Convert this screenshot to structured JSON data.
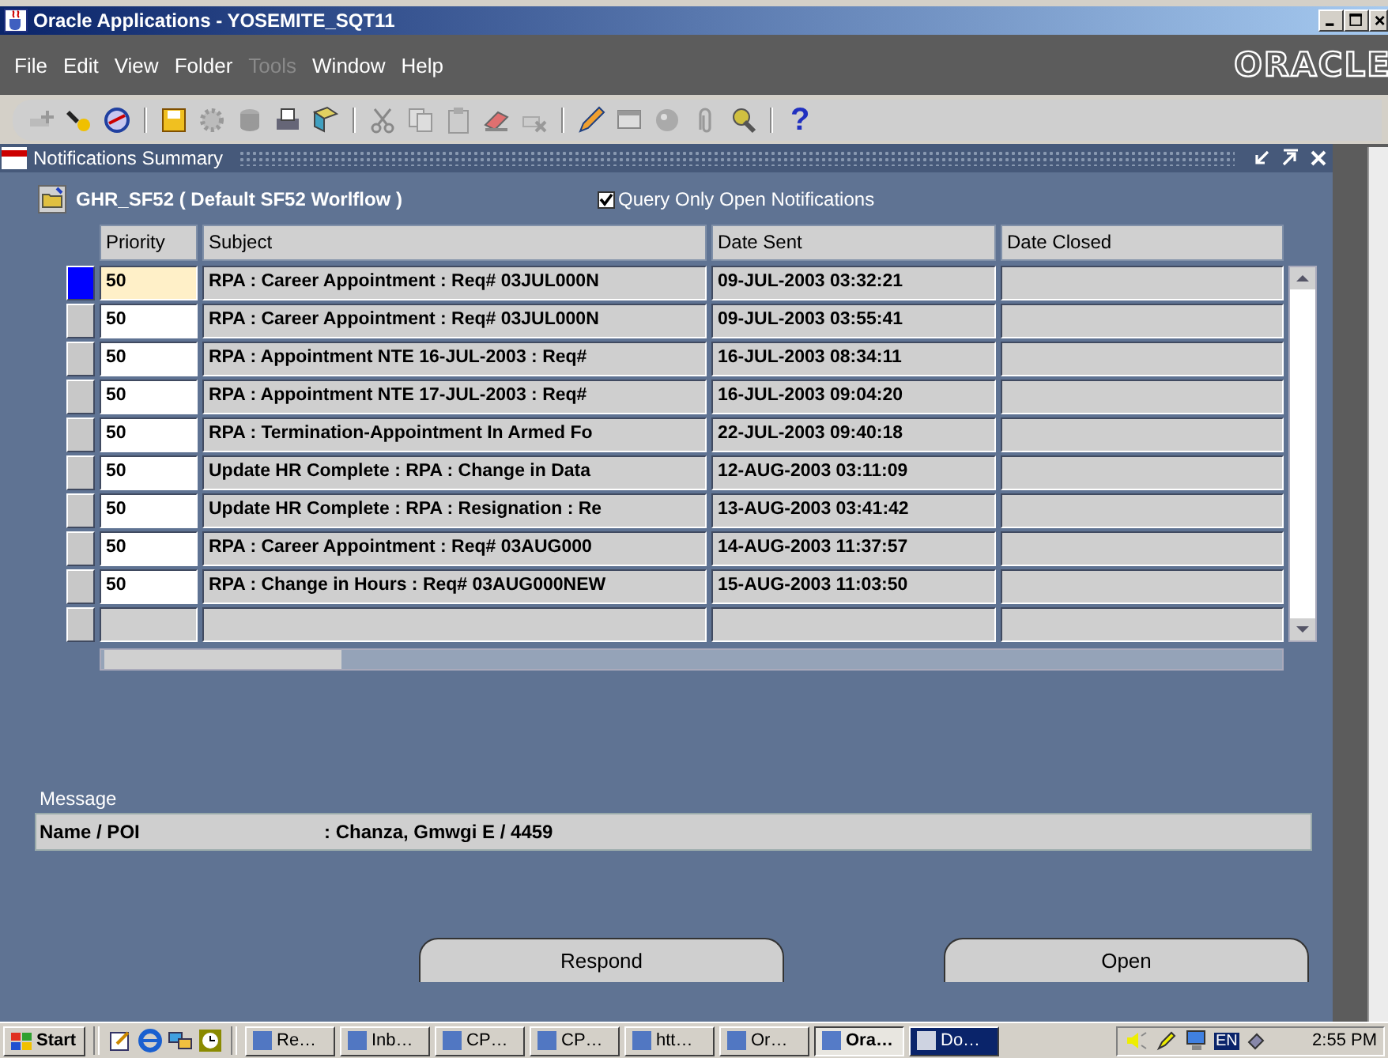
{
  "window": {
    "title": "Oracle Applications - YOSEMITE_SQT11",
    "brand": "ORACLE"
  },
  "menu": [
    {
      "label": "File",
      "disabled": false
    },
    {
      "label": "Edit",
      "disabled": false
    },
    {
      "label": "View",
      "disabled": false
    },
    {
      "label": "Folder",
      "disabled": false
    },
    {
      "label": "Tools",
      "disabled": true
    },
    {
      "label": "Window",
      "disabled": false
    },
    {
      "label": "Help",
      "disabled": false
    }
  ],
  "toolbar": {
    "help": "?"
  },
  "form": {
    "title": "Notifications Summary",
    "block_title": "GHR_SF52 ( Default SF52 Worlflow )",
    "checkbox": {
      "label": "Query Only Open Notifications",
      "checked": true
    },
    "columns": [
      "Priority",
      "Subject",
      "Date Sent",
      "Date Closed"
    ],
    "rows": [
      {
        "priority": "50",
        "subject": "RPA : Career Appointment : Req# 03JUL000N",
        "date_sent": "09-JUL-2003 03:32:21",
        "selected": true
      },
      {
        "priority": "50",
        "subject": "RPA : Career Appointment : Req# 03JUL000N",
        "date_sent": "09-JUL-2003 03:55:41",
        "selected": false
      },
      {
        "priority": "50",
        "subject": "RPA : Appointment NTE 16-JUL-2003 : Req#",
        "date_sent": "16-JUL-2003 08:34:11",
        "selected": false
      },
      {
        "priority": "50",
        "subject": "RPA : Appointment NTE 17-JUL-2003 : Req#",
        "date_sent": "16-JUL-2003 09:04:20",
        "selected": false
      },
      {
        "priority": "50",
        "subject": "RPA : Termination-Appointment In Armed Fo",
        "date_sent": "22-JUL-2003 09:40:18",
        "selected": false
      },
      {
        "priority": "50",
        "subject": "Update HR Complete : RPA : Change in Data",
        "date_sent": "12-AUG-2003 03:11:09",
        "selected": false
      },
      {
        "priority": "50",
        "subject": "Update HR Complete : RPA : Resignation : Re",
        "date_sent": "13-AUG-2003 03:41:42",
        "selected": false
      },
      {
        "priority": "50",
        "subject": "RPA : Career Appointment : Req# 03AUG000",
        "date_sent": "14-AUG-2003 11:37:57",
        "selected": false
      },
      {
        "priority": "50",
        "subject": "RPA : Change in Hours : Req# 03AUG000NEW",
        "date_sent": "15-AUG-2003 11:03:50",
        "selected": false
      }
    ],
    "message_label": "Message",
    "message_name": "Name / POI",
    "message_value": ": Chanza, Gmwgi E / 4459",
    "buttons": [
      "Respond",
      "Open"
    ]
  },
  "taskbar": {
    "start": "Start",
    "tasks": [
      {
        "label": "Re…",
        "selected": false,
        "flashing": false
      },
      {
        "label": "Inb…",
        "selected": false,
        "flashing": false
      },
      {
        "label": "CP…",
        "selected": false,
        "flashing": false
      },
      {
        "label": "CP…",
        "selected": false,
        "flashing": false
      },
      {
        "label": "htt…",
        "selected": false,
        "flashing": false
      },
      {
        "label": "Or…",
        "selected": false,
        "flashing": false
      },
      {
        "label": "Ora…",
        "selected": true,
        "flashing": false
      },
      {
        "label": "Do…",
        "selected": false,
        "flashing": true
      }
    ],
    "language": "EN",
    "clock": "2:55 PM"
  }
}
